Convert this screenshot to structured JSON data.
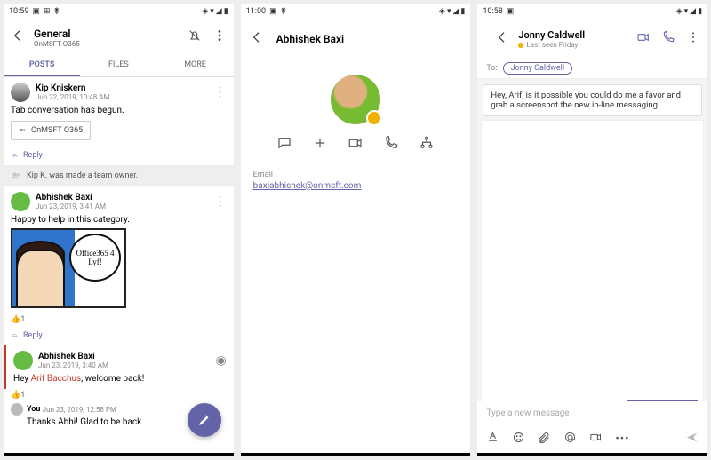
{
  "phone1": {
    "status_time": "10:59",
    "header": {
      "title": "General",
      "subtitle": "OnMSFT O365"
    },
    "tabs": {
      "posts": "POSTS",
      "files": "FILES",
      "more": "MORE"
    },
    "posts": {
      "p1": {
        "author": "Kip Kniskern",
        "time": "Jun 22, 2019, 10:48 AM",
        "text": "Tab conversation has begun.",
        "chip": "OnMSFT O365"
      },
      "sys": "Kip K. was made a team owner.",
      "p2": {
        "author": "Abhishek Baxi",
        "time": "Jun 23, 2019, 3:41 AM",
        "text": "Happy to help in this category.",
        "sticker": "Office365 4 Lyf!",
        "react": "👍1"
      },
      "p3": {
        "author": "Abhishek Baxi",
        "time": "Jun 23, 2019, 3:40 AM",
        "text_pre": "Hey ",
        "mention": "Arif Bacchus",
        "text_post": ", welcome back!",
        "react": "👍1"
      },
      "p4": {
        "author": "You",
        "time": "Jun 23, 2019, 12:58 PM",
        "text": "Thanks Abhi! Glad to be back."
      }
    },
    "reply": "Reply"
  },
  "phone2": {
    "status_time": "11:00",
    "title": "Abhishek Baxi",
    "email_label": "Email",
    "email": "baxiabhishek@onmsft.com"
  },
  "phone3": {
    "status_time": "10:58",
    "name": "Jonny Caldwell",
    "presence": "Last seen Friday",
    "to_label": "To:",
    "to_chip": "Jonny Caldwell",
    "msg": "Hey, Arif, is it possible you could do me a favor and grab a screenshot the new in-line messaging",
    "placeholder": "Type a new message"
  }
}
